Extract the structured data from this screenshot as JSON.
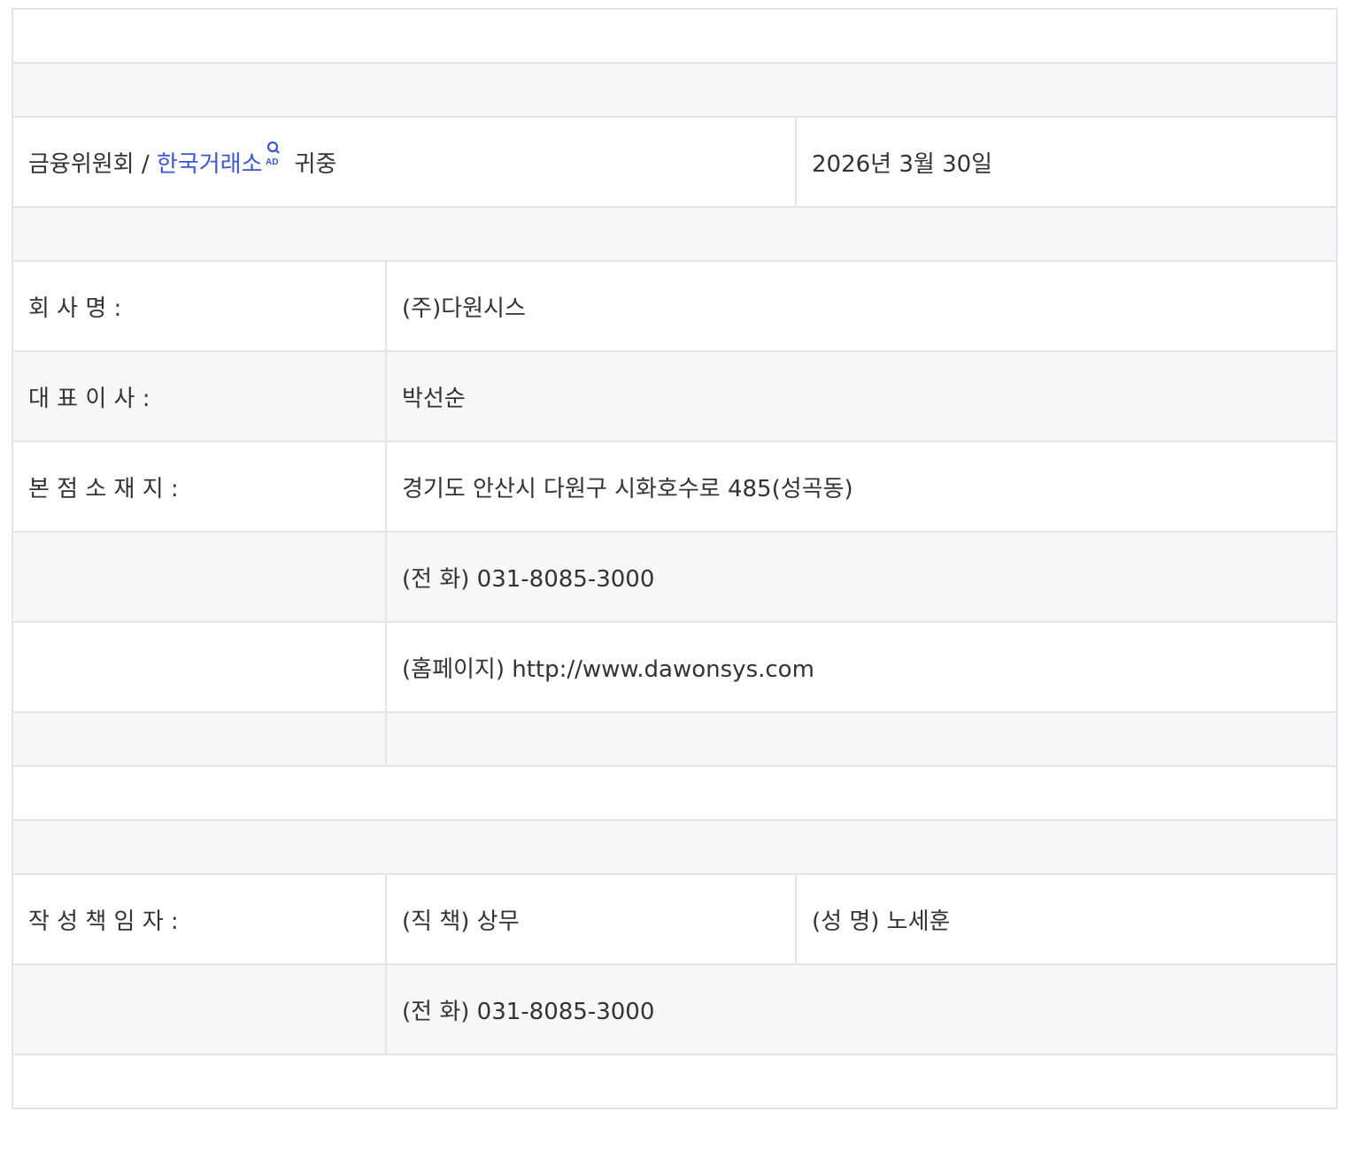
{
  "header": {
    "recipient_prefix": "금융위원회 / ",
    "recipient_link": "한국거래소",
    "ad_mark": "AD",
    "recipient_suffix": "귀중",
    "date": "2026년 3월 30일"
  },
  "company": {
    "name_label": "회 사 명 :",
    "name_value": "(주)다원시스",
    "ceo_label": "대 표 이 사 :",
    "ceo_value": "박선순",
    "hq_label": "본 점 소 재 지 :",
    "hq_address": "경기도 안산시 다원구 시화호수로 485(성곡동)",
    "hq_phone": "(전 화) 031-8085-3000",
    "hq_homepage": "(홈페이지) http://www.dawonsys.com"
  },
  "author": {
    "label": "작 성 책 임 자 :",
    "position": "(직 책) 상무",
    "name": "(성 명) 노세훈",
    "phone": "(전 화) 031-8085-3000"
  },
  "icons": {
    "ad_mark_icon": "search-magnifier-with-AD"
  },
  "colors": {
    "link": "#3a55d6",
    "border": "#e3e4e8",
    "row_alt": "#f7f7f9",
    "text": "#333333"
  }
}
